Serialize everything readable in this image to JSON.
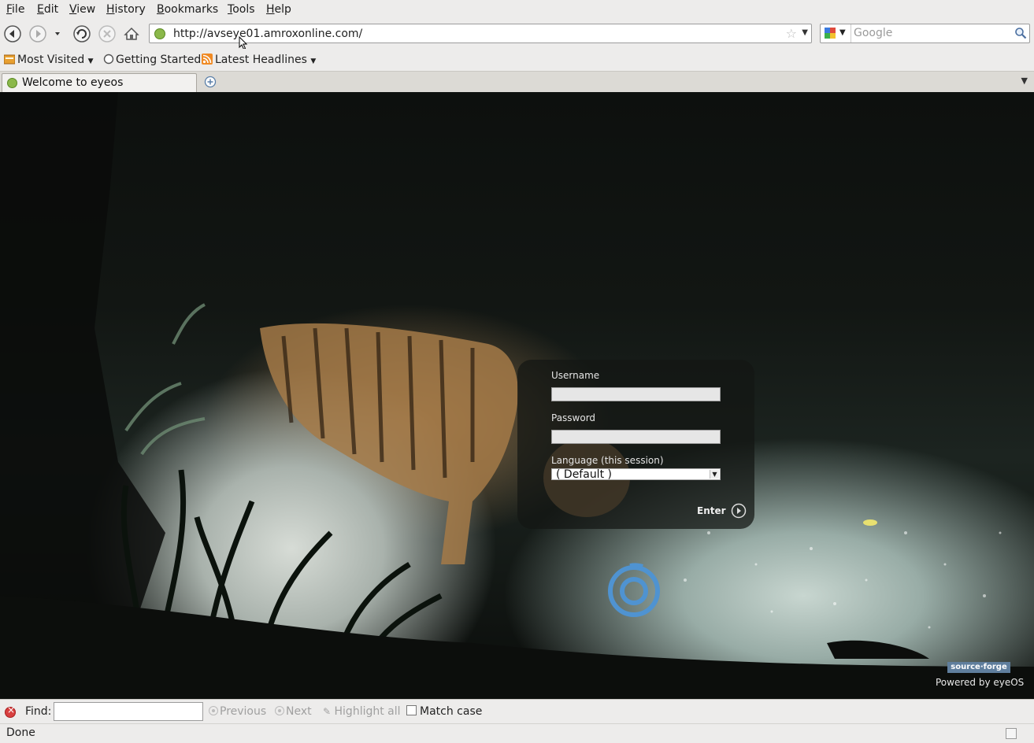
{
  "menubar": {
    "items": [
      "File",
      "Edit",
      "View",
      "History",
      "Bookmarks",
      "Tools",
      "Help"
    ]
  },
  "navbar": {
    "url": "http://avseye01.amroxonline.com/",
    "search_placeholder": "Google",
    "icons": [
      "back-icon",
      "forward-icon",
      "history-dropdown-icon",
      "reload-icon",
      "stop-icon",
      "home-icon",
      "bookmark-star-icon",
      "search-icon"
    ]
  },
  "bookmarks": {
    "items": [
      "Most Visited",
      "Getting Started",
      "Latest Headlines"
    ]
  },
  "tabs": {
    "active_label": "Welcome to eyeos"
  },
  "login": {
    "username_label": "Username",
    "password_label": "Password",
    "language_label": "Language (this session)",
    "language_value": "( Default )",
    "enter_label": "Enter"
  },
  "footer": {
    "sourceforge_badge": "source·forge",
    "powered_by": "Powered by eyeOS"
  },
  "findbar": {
    "label": "Find:",
    "previous": "Previous",
    "next": "Next",
    "highlight_all": "Highlight all",
    "match_case": "Match case"
  },
  "status": {
    "text": "Done"
  },
  "colors": {
    "chrome_bg": "#edeceb",
    "eyeos_blue": "#4f93d1",
    "login_panel": "#141614"
  }
}
